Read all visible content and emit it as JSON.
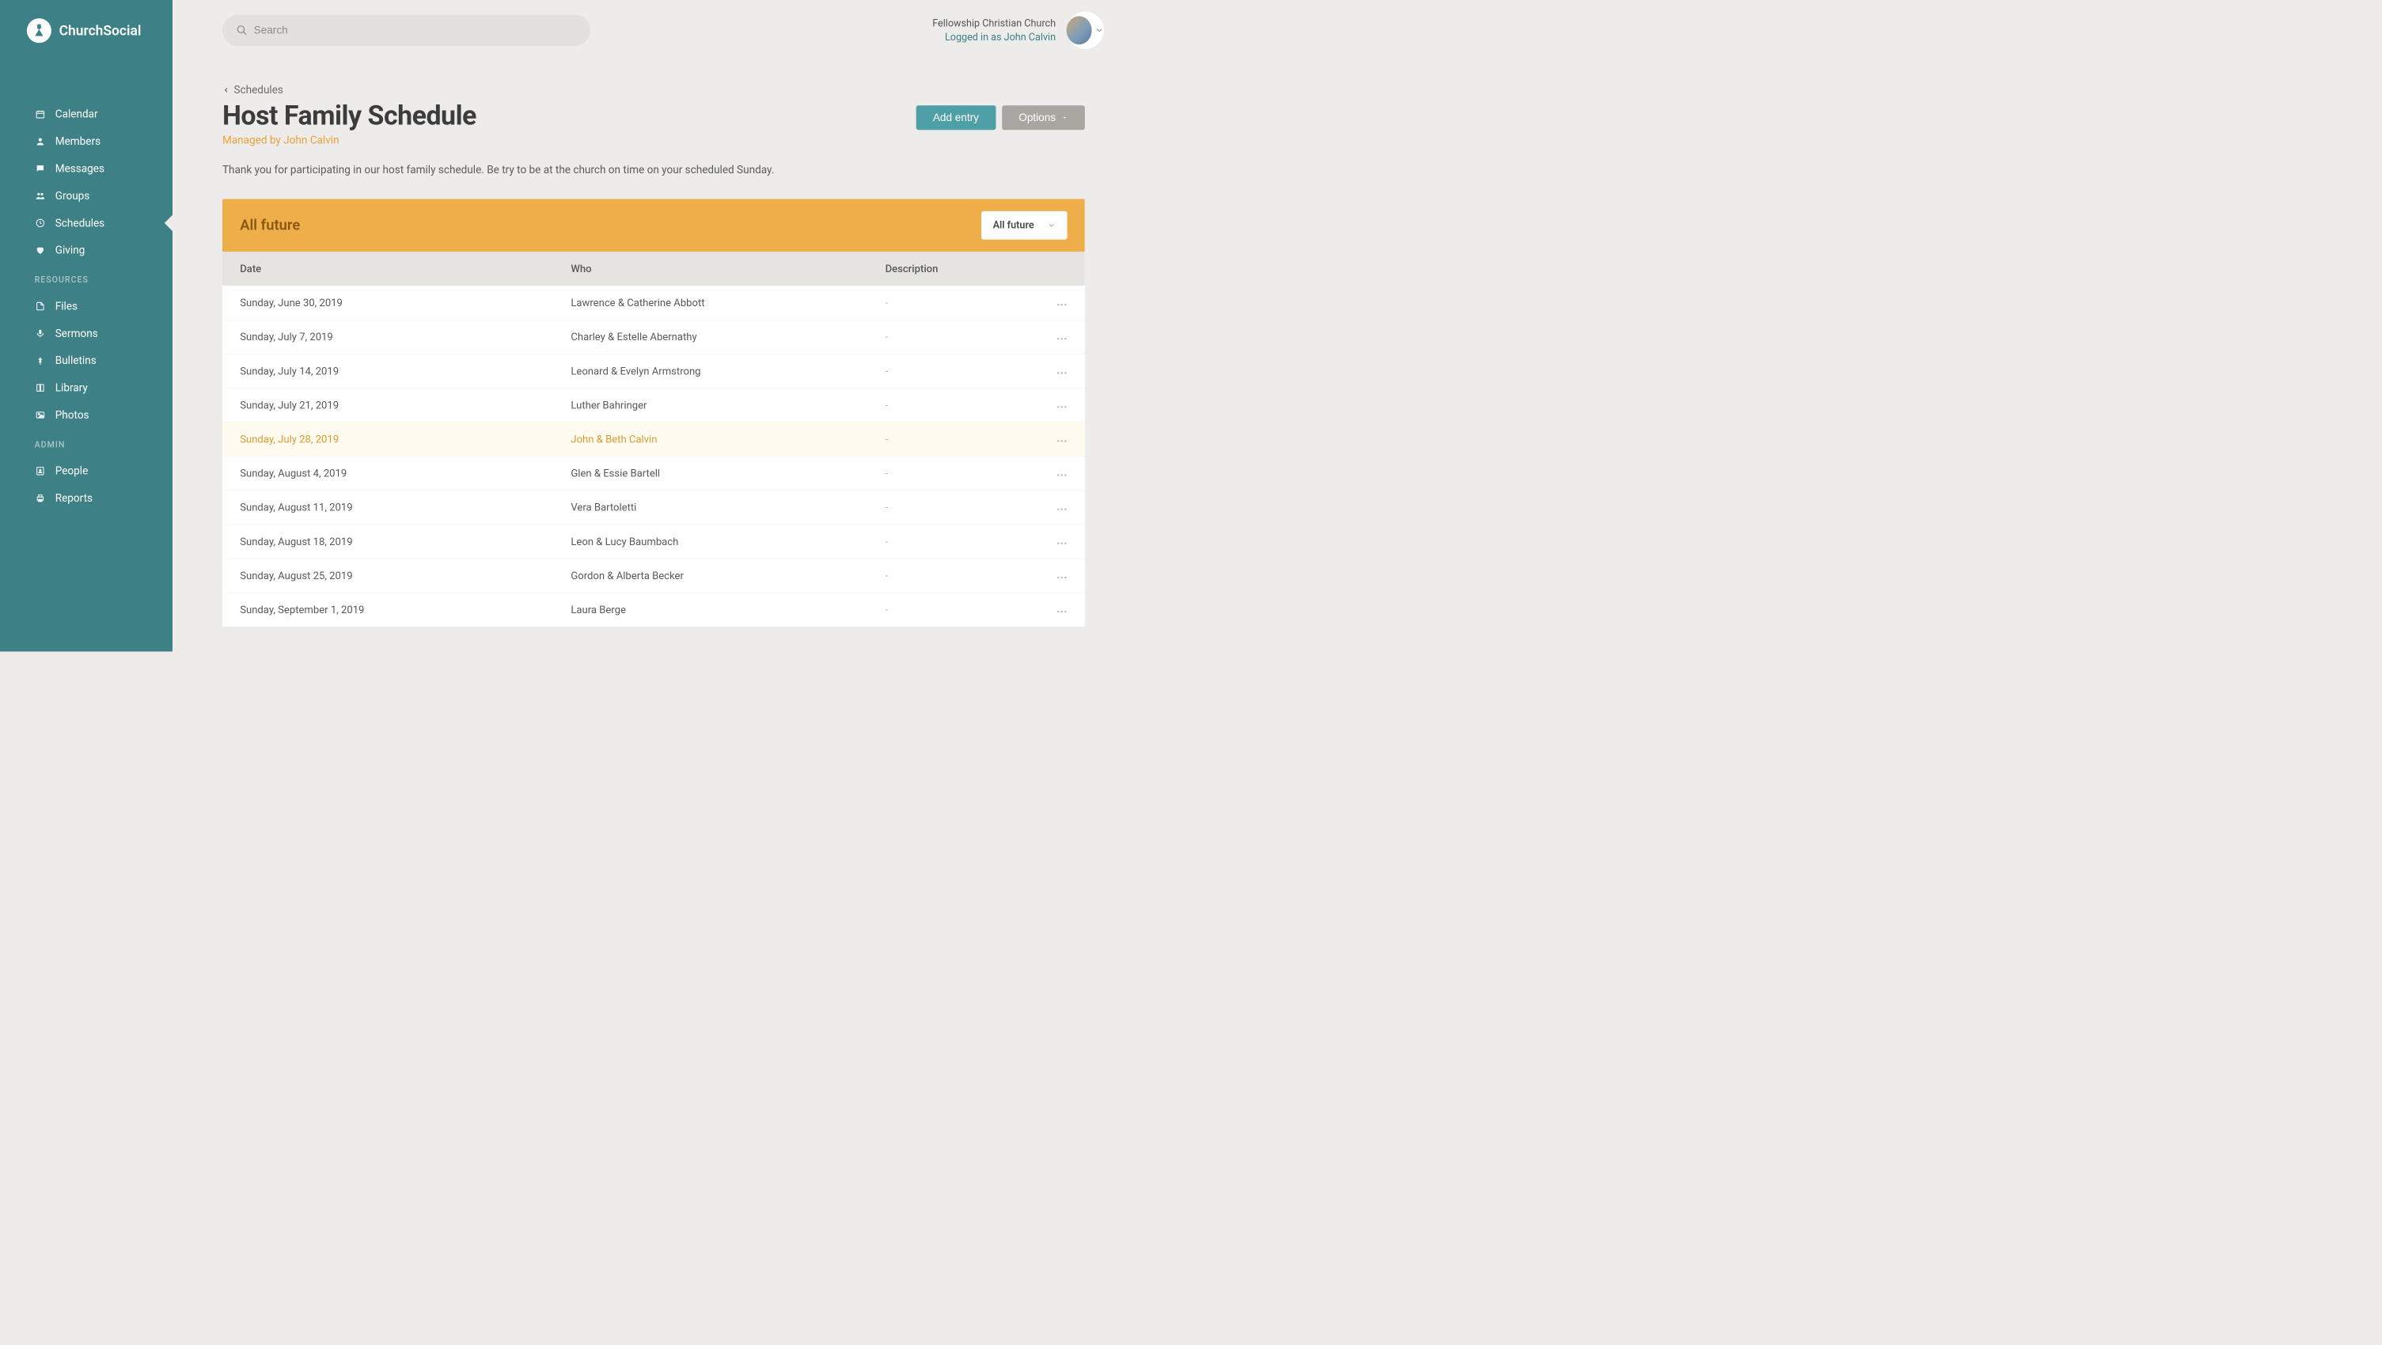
{
  "brand": {
    "name": "ChurchSocial"
  },
  "sidebar": {
    "items": [
      {
        "label": "Calendar",
        "icon": "calendar-icon"
      },
      {
        "label": "Members",
        "icon": "person-icon"
      },
      {
        "label": "Messages",
        "icon": "message-icon"
      },
      {
        "label": "Groups",
        "icon": "groups-icon"
      },
      {
        "label": "Schedules",
        "icon": "clock-icon",
        "active": true
      },
      {
        "label": "Giving",
        "icon": "heart-icon"
      }
    ],
    "resources_label": "RESOURCES",
    "resources": [
      {
        "label": "Files",
        "icon": "file-icon"
      },
      {
        "label": "Sermons",
        "icon": "mic-icon"
      },
      {
        "label": "Bulletins",
        "icon": "pin-icon"
      },
      {
        "label": "Library",
        "icon": "book-icon"
      },
      {
        "label": "Photos",
        "icon": "image-icon"
      }
    ],
    "admin_label": "ADMIN",
    "admin": [
      {
        "label": "People",
        "icon": "people-book-icon"
      },
      {
        "label": "Reports",
        "icon": "printer-icon"
      }
    ]
  },
  "search": {
    "placeholder": "Search"
  },
  "account": {
    "org": "Fellowship Christian Church",
    "user_line": "Logged in as John Calvin"
  },
  "breadcrumb": {
    "label": "Schedules"
  },
  "page": {
    "title": "Host Family Schedule",
    "managed_by": "Managed by John Calvin",
    "description": "Thank you for participating in our host family schedule. Be try to be at the church on time on your scheduled Sunday."
  },
  "buttons": {
    "add_entry": "Add entry",
    "options": "Options"
  },
  "filter": {
    "header_label": "All future",
    "selected": "All future"
  },
  "table": {
    "columns": {
      "date": "Date",
      "who": "Who",
      "description": "Description"
    },
    "empty_desc": "-",
    "rows": [
      {
        "date": "Sunday, June 30, 2019",
        "who": "Lawrence & Catherine Abbott",
        "desc": "-"
      },
      {
        "date": "Sunday, July 7, 2019",
        "who": "Charley & Estelle Abernathy",
        "desc": "-"
      },
      {
        "date": "Sunday, July 14, 2019",
        "who": "Leonard & Evelyn Armstrong",
        "desc": "-"
      },
      {
        "date": "Sunday, July 21, 2019",
        "who": "Luther Bahringer",
        "desc": "-"
      },
      {
        "date": "Sunday, July 28, 2019",
        "who": "John & Beth Calvin",
        "desc": "-",
        "highlight": true
      },
      {
        "date": "Sunday, August 4, 2019",
        "who": "Glen & Essie Bartell",
        "desc": "-"
      },
      {
        "date": "Sunday, August 11, 2019",
        "who": "Vera Bartoletti",
        "desc": "-"
      },
      {
        "date": "Sunday, August 18, 2019",
        "who": "Leon & Lucy Baumbach",
        "desc": "-"
      },
      {
        "date": "Sunday, August 25, 2019",
        "who": "Gordon & Alberta Becker",
        "desc": "-"
      },
      {
        "date": "Sunday, September 1, 2019",
        "who": "Laura Berge",
        "desc": "-"
      }
    ]
  }
}
